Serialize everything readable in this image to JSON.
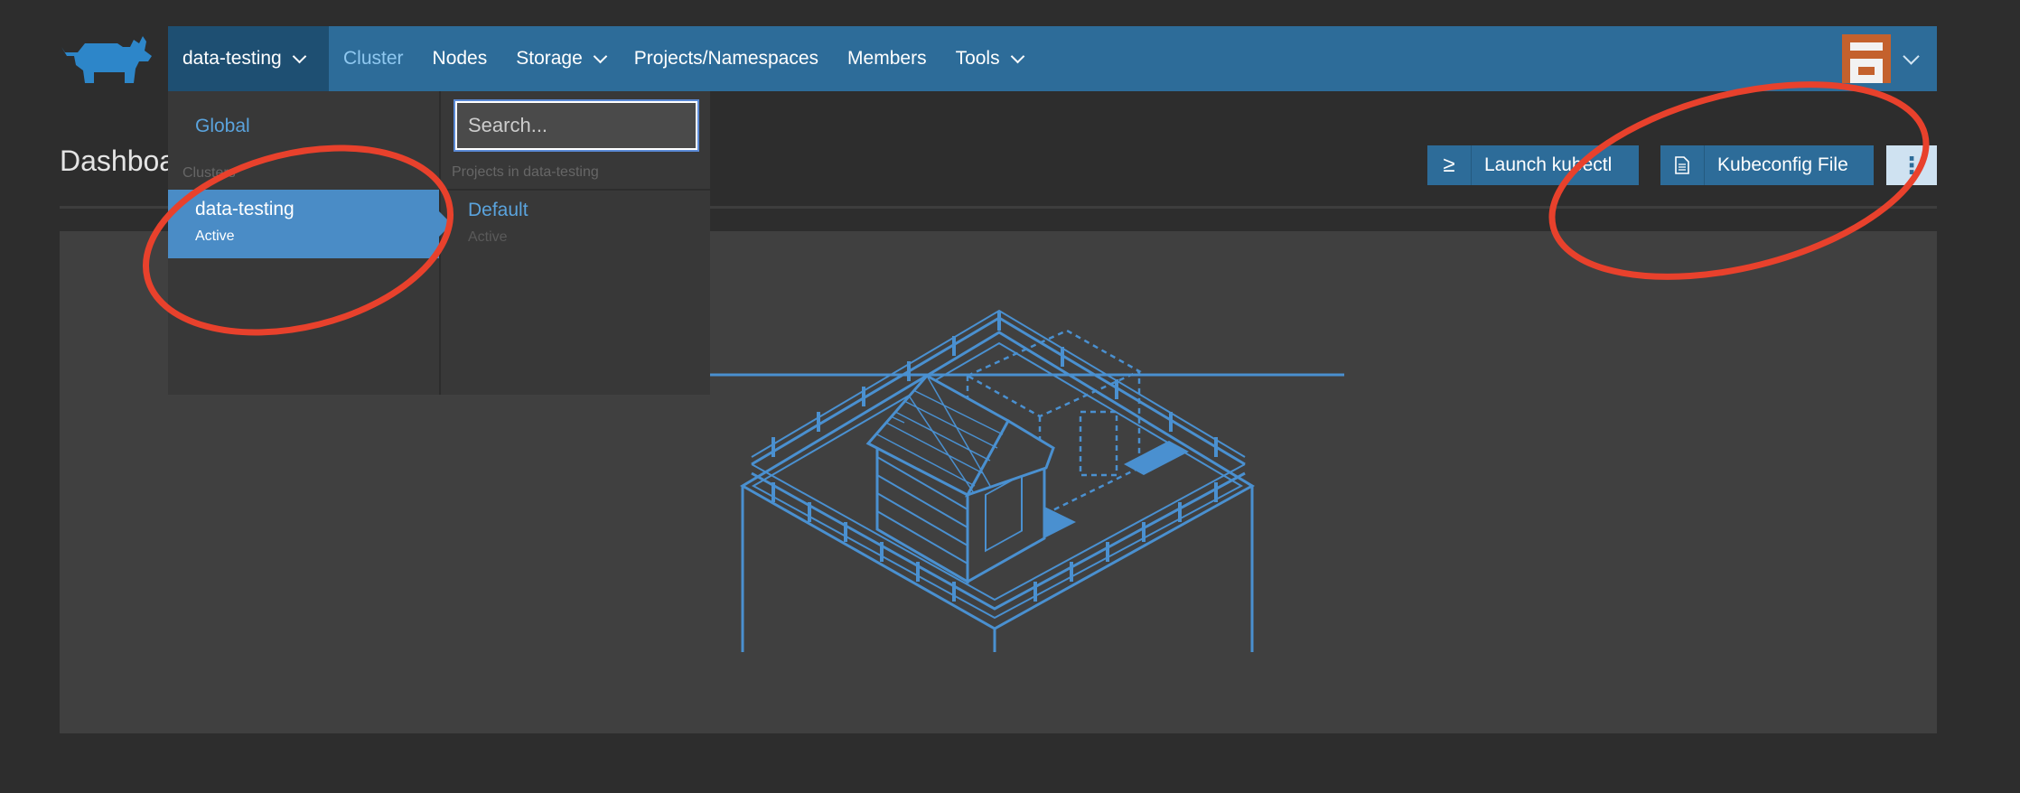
{
  "nav": {
    "cluster_switcher": "data-testing",
    "items": [
      {
        "label": "Cluster",
        "active": true
      },
      {
        "label": "Nodes"
      },
      {
        "label": "Storage",
        "has_menu": true
      },
      {
        "label": "Projects/Namespaces"
      },
      {
        "label": "Members"
      },
      {
        "label": "Tools",
        "has_menu": true
      }
    ]
  },
  "page": {
    "title": "Dashboard"
  },
  "actions": {
    "kubectl_label": "Launch kubectl",
    "kubeconfig_label": "Kubeconfig File",
    "more_label": "⋮"
  },
  "dropdown": {
    "global_label": "Global",
    "clusters_label": "Clusters",
    "cluster": {
      "name": "data-testing",
      "state": "Active"
    },
    "search_placeholder": "Search...",
    "projects_label": "Projects in data-testing",
    "project": {
      "name": "Default",
      "state": "Active"
    }
  },
  "colors": {
    "navbar": "#2d6c99",
    "accent": "#4a8cc6",
    "annotation": "#e8412c",
    "background": "#2d2d2d",
    "panel": "#404040"
  }
}
